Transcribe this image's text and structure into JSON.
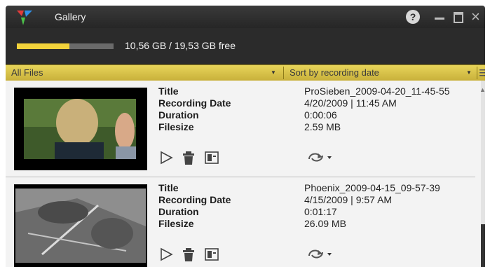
{
  "window": {
    "title": "Gallery",
    "help_label": "?",
    "close_label": "×"
  },
  "storage": {
    "used_fraction": 0.54,
    "text": "10,56 GB / 19,53 GB free"
  },
  "filter": {
    "files": "All Files",
    "sort": "Sort by recording date"
  },
  "field_labels": {
    "title": "Title",
    "recording_date": "Recording Date",
    "duration": "Duration",
    "filesize": "Filesize"
  },
  "recordings": [
    {
      "title": "ProSieben_2009-04-20_11-45-55",
      "recording_date": "4/20/2009 | 11:45 AM",
      "duration": "0:00:06",
      "filesize": "2.59 MB"
    },
    {
      "title": "Phoenix_2009-04-15_09-57-39",
      "recording_date": "4/15/2009 | 9:57 AM",
      "duration": "0:01:17",
      "filesize": "26.09 MB"
    }
  ],
  "colors": {
    "accent": "#f2d23b",
    "toolbar": "#d9c14a",
    "titlebar": "#2b2b2b"
  }
}
